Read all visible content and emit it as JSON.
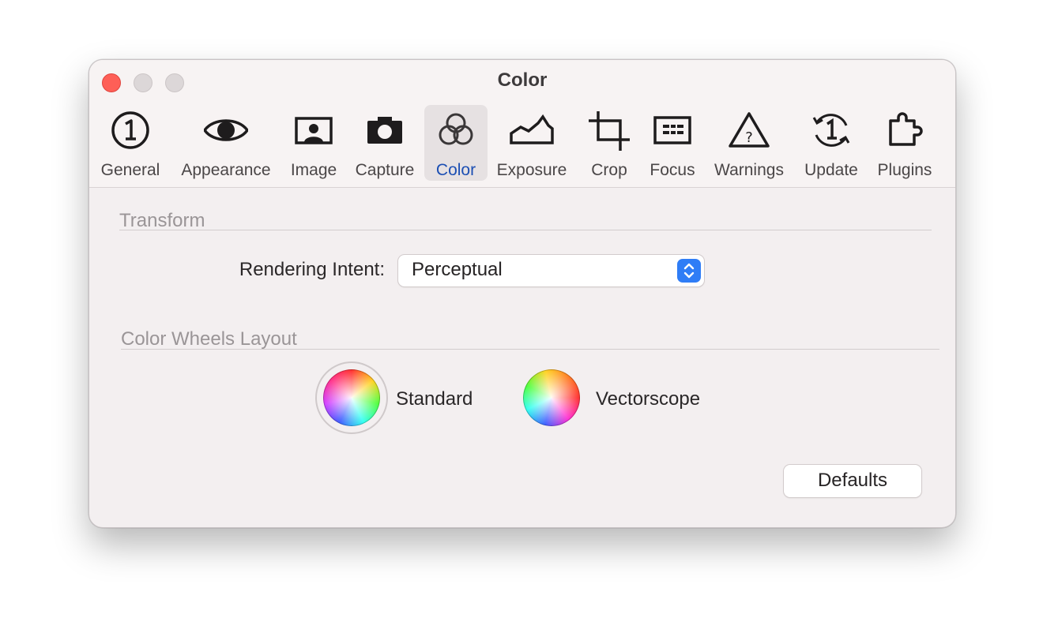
{
  "window": {
    "title": "Color",
    "controls": {
      "close": "close-button",
      "minimize": "minimize-button",
      "zoom": "zoom-button"
    }
  },
  "toolbar": {
    "selected": "Color",
    "items": [
      {
        "label": "General",
        "icon": "number-one-circle-icon"
      },
      {
        "label": "Appearance",
        "icon": "eye-icon"
      },
      {
        "label": "Image",
        "icon": "portrait-image-icon"
      },
      {
        "label": "Capture",
        "icon": "camera-icon"
      },
      {
        "label": "Color",
        "icon": "color-circles-icon"
      },
      {
        "label": "Exposure",
        "icon": "histogram-icon"
      },
      {
        "label": "Crop",
        "icon": "crop-icon"
      },
      {
        "label": "Focus",
        "icon": "focus-grid-icon"
      },
      {
        "label": "Warnings",
        "icon": "warning-triangle-icon"
      },
      {
        "label": "Update",
        "icon": "update-cycle-icon"
      },
      {
        "label": "Plugins",
        "icon": "puzzle-piece-icon"
      }
    ]
  },
  "transform": {
    "section_title": "Transform",
    "rendering_intent_label": "Rendering Intent:",
    "rendering_intent_value": "Perceptual"
  },
  "color_wheels": {
    "section_title": "Color Wheels Layout",
    "options": [
      {
        "label": "Standard",
        "selected": true
      },
      {
        "label": "Vectorscope",
        "selected": false
      }
    ]
  },
  "footer": {
    "defaults_label": "Defaults"
  },
  "colors": {
    "close": "#fe5f57",
    "accent": "#2f7df6",
    "selected_tab_text": "#1c4fb3"
  }
}
